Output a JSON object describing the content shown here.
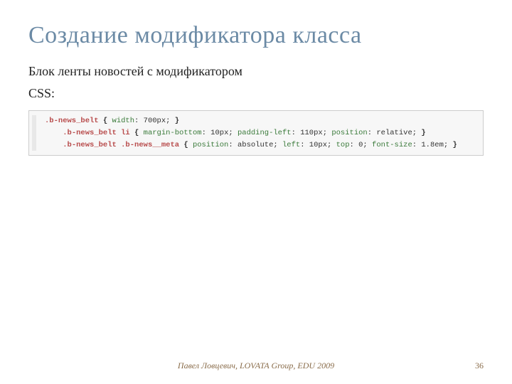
{
  "title": "Создание модификатора класса",
  "body": {
    "line1": "Блок ленты новостей с модификатором",
    "line2": "CSS:"
  },
  "code": {
    "l1": {
      "sel": ".b-news_belt",
      "rest": " { ",
      "p1": "width",
      "v1": ": 700px;",
      "close": " }"
    },
    "l2": {
      "indent": "    ",
      "sel": ".b-news_belt li",
      "rest": " { ",
      "p1": "margin-bottom",
      "v1": ": 10px;",
      "p2": " padding-left",
      "v2": ": 110px;",
      "p3": " position",
      "v3": ": relative;",
      "close": " }"
    },
    "l3": {
      "indent": "    ",
      "sel": ".b-news_belt .b-news__meta",
      "rest": " { ",
      "p1": "position",
      "v1": ": absolute;",
      "p2": " left",
      "v2": ": 10px;",
      "p3": " top",
      "v3": ": 0;",
      "p4": " font-size",
      "v4": ": 1.8em;",
      "close": " }"
    }
  },
  "footer": "Павел Ловцевич, LOVATA Group, EDU 2009",
  "page": "36"
}
